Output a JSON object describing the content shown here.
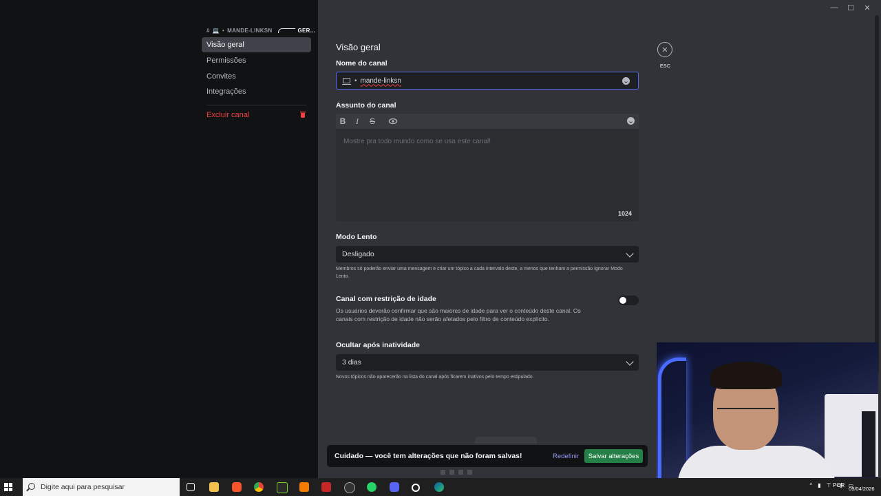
{
  "window": {
    "minimize": "—",
    "maximize": "☐",
    "close": "✕"
  },
  "sidebar": {
    "breadcrumb": {
      "hash": "#",
      "channel": "MANDE-LINKSN",
      "category": "GER..."
    },
    "items": [
      {
        "label": "Visão geral",
        "active": true
      },
      {
        "label": "Permissões"
      },
      {
        "label": "Convites"
      },
      {
        "label": "Integrações"
      }
    ],
    "delete_label": "Excluir canal"
  },
  "main": {
    "title": "Visão geral",
    "channel_name": {
      "label": "Nome do canal",
      "value": "mande-linksn"
    },
    "topic": {
      "label": "Assunto do canal",
      "placeholder": "Mostre pra todo mundo como se usa este canal!",
      "counter": "1024",
      "tools": [
        "B",
        "I",
        "S",
        "preview"
      ]
    },
    "slowmode": {
      "label": "Modo Lento",
      "value": "Desligado",
      "help": "Membros só poderão enviar uma mensagem e criar um tópico a cada intervalo deste, a menos que tenham a permissão Ignorar Modo Lento."
    },
    "age_restricted": {
      "label": "Canal com restrição de idade",
      "help": "Os usuários deverão confirmar que são maiores de idade para ver o conteúdo deste canal. Os canais com restrição de idade não serão afetados pelo filtro de conteúdo explícito.",
      "enabled": false
    },
    "hide_after_inactivity": {
      "label": "Ocultar após inatividade",
      "value": "3 dias",
      "help": "Novos tópicos não aparecerão na lista do canal após ficarem inativos pelo tempo estipulado."
    },
    "esc": {
      "icon": "✕",
      "label": "ESC"
    }
  },
  "unsaved_bar": {
    "message": "Cuidado — você tem alterações que não foram salvas!",
    "reset_label": "Redefinir",
    "save_label": "Salvar alterações"
  },
  "taskbar": {
    "search_placeholder": "Digite aqui para pesquisar",
    "language": "POR",
    "date": "09/04/2026"
  },
  "colors": {
    "accent": "#5865f2",
    "danger": "#f23f43",
    "save": "#248046",
    "link": "#949cf7"
  }
}
